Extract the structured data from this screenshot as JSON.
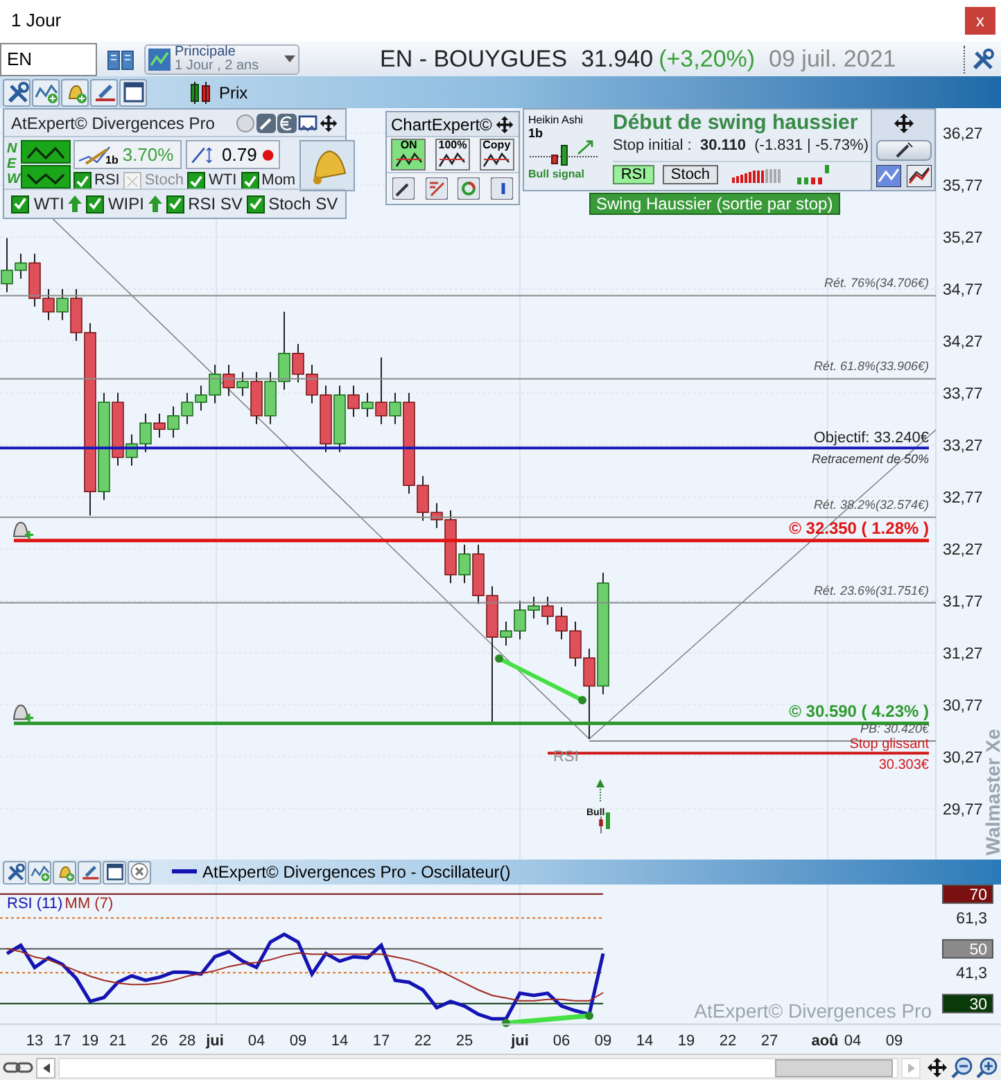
{
  "window": {
    "title": "1 Jour",
    "close": "x"
  },
  "toolbar": {
    "symbol": "EN",
    "layout": {
      "name": "Principale",
      "detail": "1 Jour , 2 ans"
    },
    "quote": {
      "name": "EN - BOUYGUES",
      "price": "31.940",
      "change": "(+3,20%)",
      "date": "09 juil. 2021"
    }
  },
  "price_bar": {
    "label": "Prix"
  },
  "divergences_panel": {
    "title": "AtExpert© Divergences Pro",
    "new_letters": [
      "N",
      "E",
      "W"
    ],
    "threshold": "3.70%",
    "threshold_period": "1b",
    "ratio": "0.79",
    "checks": [
      {
        "label": "RSI",
        "checked": true
      },
      {
        "label": "Stoch",
        "checked": false
      },
      {
        "label": "WTI",
        "checked": true
      },
      {
        "label": "Mom",
        "checked": true
      }
    ],
    "signals": [
      {
        "label": "WTI",
        "checked": true,
        "arrow": true
      },
      {
        "label": "WIPI",
        "checked": true,
        "arrow": true
      },
      {
        "label": "RSI SV",
        "checked": true,
        "arrow": false
      },
      {
        "label": "Stoch SV",
        "checked": true,
        "arrow": false
      }
    ]
  },
  "chartexpert_panel": {
    "title": "ChartExpert©",
    "buttons": [
      "ON",
      "100%",
      "Copy"
    ]
  },
  "signal_panel": {
    "pattern": "Heikin Ashi",
    "period": "1b",
    "signal": "Bull signal",
    "title": "Début de swing haussier",
    "stop": "Stop initial :  **30.110**  (-1.831 | -5.73%)",
    "filters": [
      {
        "label": "RSI",
        "selected": true
      },
      {
        "label": "Stoch",
        "selected": false
      }
    ],
    "meter": {
      "level": 0.67
    }
  },
  "swing_badge": "Swing Haussier (sortie par stop)",
  "price_chart": {
    "chart_data": {
      "type": "candlestick",
      "grid": true,
      "categories": [
        null,
        null,
        null,
        null,
        null,
        null,
        null,
        null,
        null,
        null,
        null,
        null,
        null,
        null,
        null,
        null,
        null,
        null,
        null,
        null,
        null,
        null,
        null,
        null,
        null,
        null,
        null,
        null,
        null,
        null,
        null,
        null,
        null,
        null,
        null,
        null,
        null,
        null,
        null,
        null,
        null,
        null,
        null,
        null,
        null,
        null,
        null,
        null,
        null,
        null,
        null,
        null,
        null,
        null,
        null,
        null,
        null,
        null,
        null,
        null,
        null,
        null,
        null,
        null,
        null,
        null,
        null,
        null
      ],
      "ylim": [
        29.28,
        36.51
      ],
      "yticks": [
        {
          "value": 36.27,
          "label": "36,27"
        },
        {
          "value": 35.77,
          "label": "35,77"
        },
        {
          "value": 35.27,
          "label": "35,27"
        },
        {
          "value": 34.77,
          "label": "34,77"
        },
        {
          "value": 34.27,
          "label": "34,27"
        },
        {
          "value": 33.77,
          "label": "33,77"
        },
        {
          "value": 33.27,
          "label": "33,27"
        },
        {
          "value": 32.77,
          "label": "32,77"
        },
        {
          "value": 32.27,
          "label": "32,27"
        },
        {
          "value": 31.77,
          "label": "31,77"
        },
        {
          "value": 31.27,
          "label": "31,27"
        },
        {
          "value": 30.77,
          "label": "30,77"
        },
        {
          "value": 30.27,
          "label": "30,27"
        },
        {
          "value": 29.77,
          "label": "29,77"
        }
      ],
      "ohlc": [
        [
          34.82,
          35.26,
          34.74,
          34.95
        ],
        [
          34.95,
          35.11,
          34.87,
          35.02
        ],
        [
          35.02,
          35.11,
          34.6,
          34.68
        ],
        [
          34.68,
          34.77,
          34.47,
          34.55
        ],
        [
          34.55,
          34.77,
          34.47,
          34.68
        ],
        [
          34.68,
          34.77,
          34.27,
          34.35
        ],
        [
          34.35,
          34.44,
          32.59,
          32.82
        ],
        [
          32.82,
          33.77,
          32.74,
          33.68
        ],
        [
          33.68,
          33.77,
          33.07,
          33.15
        ],
        [
          33.15,
          33.37,
          33.07,
          33.28
        ],
        [
          33.28,
          33.57,
          33.2,
          33.48
        ],
        [
          33.48,
          33.57,
          33.34,
          33.42
        ],
        [
          33.42,
          33.64,
          33.34,
          33.55
        ],
        [
          33.55,
          33.77,
          33.47,
          33.68
        ],
        [
          33.68,
          33.84,
          33.6,
          33.75
        ],
        [
          33.75,
          34.04,
          33.67,
          33.95
        ],
        [
          33.95,
          34.04,
          33.74,
          33.82
        ],
        [
          33.82,
          33.97,
          33.74,
          33.88
        ],
        [
          33.88,
          33.97,
          33.47,
          33.55
        ],
        [
          33.55,
          33.97,
          33.47,
          33.88
        ],
        [
          33.88,
          34.55,
          33.8,
          34.15
        ],
        [
          34.15,
          34.24,
          33.87,
          33.95
        ],
        [
          33.95,
          34.04,
          33.67,
          33.75
        ],
        [
          33.75,
          33.84,
          33.2,
          33.28
        ],
        [
          33.28,
          33.84,
          33.2,
          33.75
        ],
        [
          33.75,
          33.84,
          33.54,
          33.62
        ],
        [
          33.62,
          33.77,
          33.54,
          33.68
        ],
        [
          33.68,
          34.11,
          33.47,
          33.55
        ],
        [
          33.55,
          33.77,
          33.47,
          33.68
        ],
        [
          33.68,
          33.77,
          32.8,
          32.88
        ],
        [
          32.88,
          32.97,
          32.54,
          32.62
        ],
        [
          32.62,
          32.71,
          32.47,
          32.55
        ],
        [
          32.55,
          32.64,
          31.94,
          32.02
        ],
        [
          32.02,
          32.31,
          31.94,
          32.22
        ],
        [
          32.22,
          32.31,
          31.74,
          31.82
        ],
        [
          31.82,
          31.91,
          30.6,
          31.42
        ],
        [
          31.42,
          31.57,
          31.34,
          31.48
        ],
        [
          31.48,
          31.77,
          31.4,
          31.68
        ],
        [
          31.68,
          31.81,
          31.6,
          31.72
        ],
        [
          31.72,
          31.81,
          31.54,
          31.62
        ],
        [
          31.62,
          31.71,
          31.4,
          31.48
        ],
        [
          31.48,
          31.57,
          31.14,
          31.22
        ],
        [
          31.22,
          31.31,
          30.44,
          30.95
        ],
        [
          30.95,
          32.04,
          30.87,
          31.94
        ],
        null,
        null,
        null,
        null,
        null,
        null,
        null,
        null,
        null,
        null,
        null,
        null,
        null,
        null,
        null,
        null,
        null,
        null,
        null,
        null,
        null,
        null,
        null,
        null
      ],
      "ref_lines": [
        {
          "axis": "y",
          "value": 34.706,
          "label": "Rét. 76%(34.706€)",
          "color": "#8a8a8a"
        },
        {
          "axis": "y",
          "value": 33.906,
          "label": "Rét. 61.8%(33.906€)",
          "color": "#8a8a8a"
        },
        {
          "axis": "y",
          "value": 33.24,
          "label": "Objectif: 33.240€",
          "color": "#1818b8"
        },
        {
          "axis": "y",
          "value": 32.574,
          "label": "Rét. 38.2%(32.574€)",
          "color": "#8a8a8a"
        },
        {
          "axis": "y",
          "value": 32.35,
          "label": "© 32.350 ( 1.28% )",
          "color": "#e01414"
        },
        {
          "axis": "y",
          "value": 31.751,
          "label": "Rét. 23.6%(31.751€)",
          "color": "#8a8a8a"
        },
        {
          "axis": "y",
          "value": 30.59,
          "label": "© 30.590 ( 4.23% )",
          "color": "#2e9a2e"
        },
        {
          "axis": "y",
          "value": 30.42,
          "label": "PB: 30.420€",
          "color": "#8a8a8a"
        },
        {
          "axis": "y",
          "value": 30.303,
          "label": "Stop glissant",
          "color": "#d01818"
        }
      ]
    }
  },
  "levels": [
    {
      "kind": "fib"
    },
    {
      "kind": "fib"
    },
    {
      "kind": "objective",
      "note": "Retracement de 50%"
    },
    {
      "kind": "fib"
    },
    {
      "kind": "alert"
    },
    {
      "kind": "fib"
    },
    {
      "kind": "alert"
    },
    {
      "kind": "pb"
    },
    {
      "kind": "stop",
      "note": "30.303€"
    }
  ],
  "divergence_label": "RSI",
  "bull_marker": "Bull",
  "vertical_caption": "Walmaster Xe",
  "oscillator": {
    "legend": "AtExpert© Divergences Pro - Oscillateur()",
    "footer": "AtExpert© Divergences Pro",
    "chart_data": {
      "type": "line",
      "grid": true,
      "categories": [
        null,
        null,
        "13",
        null,
        "17",
        null,
        "19",
        null,
        "21",
        null,
        null,
        "26",
        null,
        "28",
        null,
        "jui",
        null,
        null,
        "04",
        null,
        null,
        "09",
        null,
        null,
        "14",
        null,
        null,
        "17",
        null,
        null,
        "22",
        null,
        null,
        "25",
        null,
        null,
        null,
        "jui",
        null,
        null,
        "06",
        null,
        null,
        "09",
        null,
        null,
        "14",
        null,
        null,
        "19",
        null,
        null,
        "22",
        null,
        null,
        "27",
        null,
        null,
        null,
        "aoû",
        null,
        "04",
        null,
        null,
        "09",
        null,
        null,
        null
      ],
      "ylim": [
        23,
        73.5
      ],
      "yticks": [
        {
          "value": 70,
          "label": "70"
        },
        {
          "value": 61.3,
          "label": "61,3"
        },
        {
          "value": 50,
          "label": "50"
        },
        {
          "value": 41.3,
          "label": "41,3"
        },
        {
          "value": 30,
          "label": "30"
        }
      ],
      "ref_lines": [
        {
          "axis": "y",
          "value": 70,
          "color": "#7a1010"
        },
        {
          "axis": "y",
          "value": 61.3,
          "color": "#e07020"
        },
        {
          "axis": "y",
          "value": 50,
          "color": "#555555"
        },
        {
          "axis": "y",
          "value": 41.3,
          "color": "#e07020"
        },
        {
          "axis": "y",
          "value": 30,
          "color": "#0a3a0a"
        }
      ],
      "series": [
        {
          "name": "RSI (11)",
          "color": "#1414b4",
          "values": [
            48.3,
            51.3,
            43.2,
            46.7,
            44.3,
            39.2,
            30.8,
            32.2,
            37.8,
            40.1,
            38.5,
            39.6,
            41.5,
            41.5,
            40.8,
            47.1,
            49.0,
            45.5,
            43.2,
            52.5,
            55.3,
            52.5,
            40.8,
            48.3,
            45.5,
            47.1,
            46.7,
            51.3,
            38.5,
            37.8,
            35.0,
            28.5,
            30.8,
            29.1,
            26.1,
            24.4,
            24.4,
            33.8,
            33.0,
            33.8,
            29.1,
            27.4,
            26.1,
            48.3,
            null,
            null,
            null,
            null,
            null,
            null,
            null,
            null,
            null,
            null,
            null,
            null,
            null,
            null,
            null,
            null,
            null,
            null,
            null,
            null,
            null,
            null,
            null,
            null
          ]
        },
        {
          "name": "MM (7)",
          "color": "#a0281e",
          "values": [
            50,
            49,
            47,
            46,
            44,
            42,
            40,
            38.5,
            37.5,
            37,
            37,
            37.5,
            38.5,
            40,
            41,
            42,
            43.5,
            44.5,
            45,
            46,
            47.5,
            48.5,
            48,
            48,
            48,
            48,
            48,
            48,
            47,
            46,
            44.5,
            42.5,
            40,
            37.5,
            35,
            33,
            32,
            31,
            31,
            31.5,
            31.5,
            31,
            31,
            34,
            null,
            null,
            null,
            null,
            null,
            null,
            null,
            null,
            null,
            null,
            null,
            null,
            null,
            null,
            null,
            null,
            null,
            null,
            null,
            null,
            null,
            null,
            null,
            null
          ]
        }
      ]
    }
  }
}
